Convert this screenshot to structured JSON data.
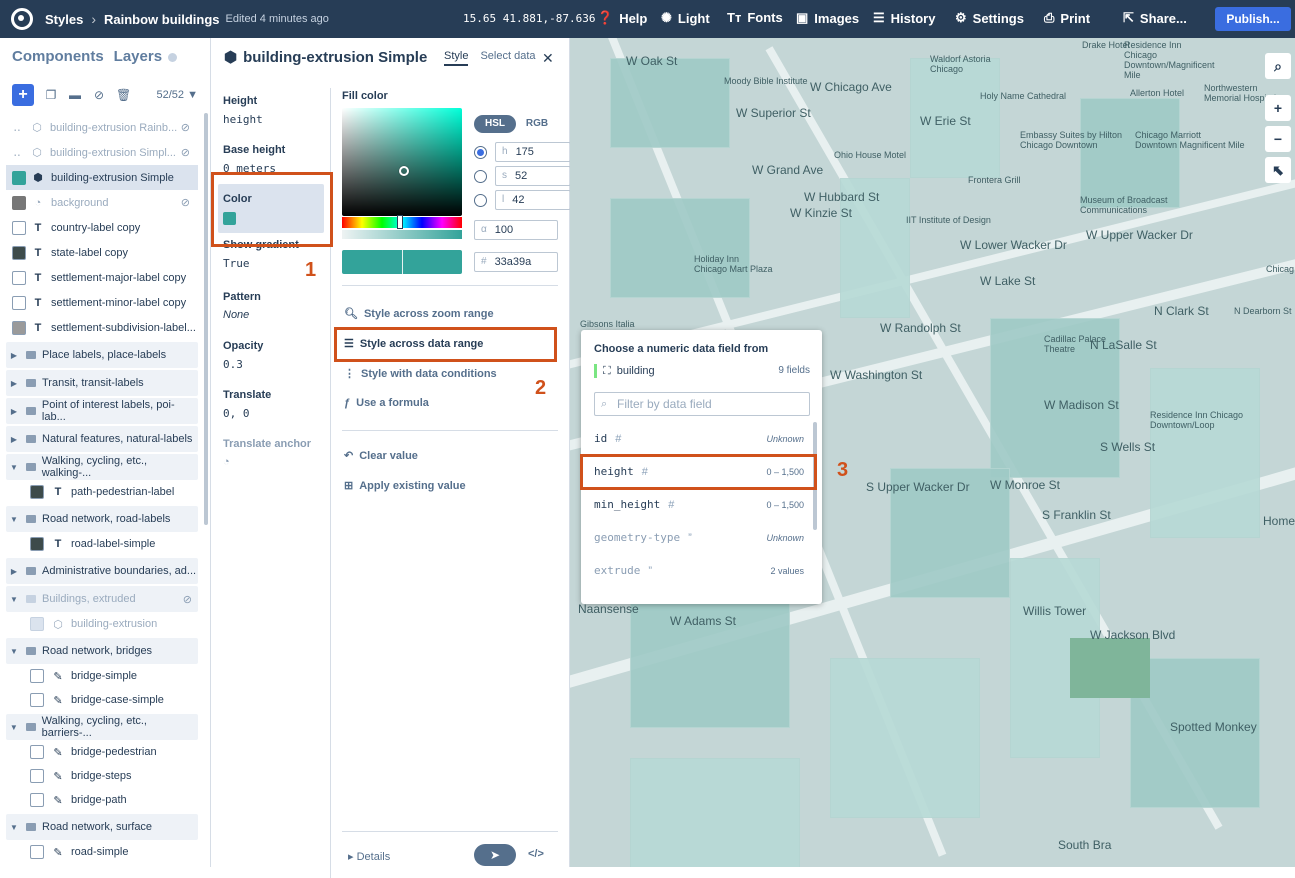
{
  "topbar": {
    "crumb1": "Styles",
    "crumb2": "Rainbow buildings",
    "edited": "Edited 4 minutes ago",
    "coords": "15.65 41.881,-87.636",
    "help": "Help",
    "light": "Light",
    "fonts": "Fonts",
    "images": "Images",
    "history": "History",
    "settings": "Settings",
    "print": "Print",
    "share": "Share...",
    "publish": "Publish..."
  },
  "leftpanel": {
    "tab_components": "Components",
    "tab_layers": "Layers",
    "layer_count": "52/52",
    "layers": [
      {
        "label": "building-extrusion Rainb...",
        "swatch": "",
        "icon": "cube"
      },
      {
        "label": "building-extrusion Simpl...",
        "swatch": "",
        "icon": "cube"
      },
      {
        "label": "building-extrusion Simple",
        "swatch": "#33a39a",
        "icon": "cube"
      },
      {
        "label": "background",
        "swatch": "#777777",
        "icon": "paint"
      },
      {
        "label": "country-label copy",
        "swatch": "",
        "icon": "T"
      },
      {
        "label": "state-label copy",
        "swatch": "#3d4b4b",
        "icon": "T"
      },
      {
        "label": "settlement-major-label copy",
        "swatch": "",
        "icon": "T"
      },
      {
        "label": "settlement-minor-label copy",
        "swatch": "",
        "icon": "T"
      },
      {
        "label": "settlement-subdivision-label...",
        "swatch": "#9a9a9a",
        "icon": "T"
      }
    ],
    "groups": [
      "Place labels, place-labels",
      "Transit, transit-labels",
      "Point of interest labels, poi-lab...",
      "Natural features, natural-labels",
      "Walking, cycling, etc., walking-...",
      "Road network, road-labels",
      "Administrative boundaries, ad...",
      "Buildings, extruded",
      "Road network, bridges",
      "Walking, cycling, etc., barriers-...",
      "Road network, surface"
    ],
    "children": {
      "path_pedestrian": "path-pedestrian-label",
      "road_label_simple": "road-label-simple",
      "building_extrusion": "building-extrusion",
      "bridge_simple": "bridge-simple",
      "bridge_case_simple": "bridge-case-simple",
      "bridge_pedestrian": "bridge-pedestrian",
      "bridge_steps": "bridge-steps",
      "bridge_path": "bridge-path",
      "road_simple": "road-simple"
    }
  },
  "props": {
    "title": "building-extrusion Simple",
    "tab_style": "Style",
    "tab_select": "Select data",
    "items": [
      {
        "k": "Height",
        "v": "height"
      },
      {
        "k": "Base height",
        "v": "0 meters"
      },
      {
        "k": "Color",
        "v": ""
      },
      {
        "k": "Show gradient",
        "v": "True"
      },
      {
        "k": "Pattern",
        "v": "None"
      },
      {
        "k": "Opacity",
        "v": "0.3"
      },
      {
        "k": "Translate",
        "v": "0, 0"
      },
      {
        "k": "Translate anchor",
        "v": ""
      }
    ],
    "fill_color": "Fill color",
    "mode_hsl": "HSL",
    "mode_rgb": "RGB",
    "h": "175",
    "s": "52",
    "l": "42",
    "alpha": "100",
    "hex": "33a39a",
    "opt_zoom": "Style across zoom range",
    "opt_data": "Style across data range",
    "opt_cond": "Style with data conditions",
    "opt_formula": "Use a formula",
    "clear": "Clear value",
    "apply": "Apply existing value",
    "details": "Details"
  },
  "dropdown": {
    "title": "Choose a numeric data field from",
    "source": "building",
    "count": "9 fields",
    "placeholder": "Filter by data field",
    "fields": [
      {
        "name": "id",
        "range": "Unknown"
      },
      {
        "name": "height",
        "range": "0 – 1,500"
      },
      {
        "name": "min_height",
        "range": "0 – 1,500"
      },
      {
        "name": "geometry-type",
        "range": "Unknown"
      },
      {
        "name": "extrude",
        "range": "2 values"
      }
    ]
  },
  "map": {
    "labels": [
      "Drake Hotel",
      "Residence Inn Chicago Downtown/Magnificent Mile",
      "W Oak St",
      "Waldorf Astoria Chicago",
      "Moody Bible Institute",
      "W Chicago Ave",
      "Holy Name Cathedral",
      "Allerton Hotel",
      "Northwestern Memorial Hospital",
      "W Superior St",
      "W Erie St",
      "Embassy Suites by Hilton Chicago Downtown",
      "Chicago Marriott Downtown Magnificent Mile",
      "Ohio House Motel",
      "W Grand Ave",
      "Frontera Grill",
      "W Hubbard St",
      "W Kinzie St",
      "Museum of Broadcast Communications",
      "IIT Institute of Design",
      "W Lower Wacker Dr",
      "W Upper Wacker Dr",
      "Holiday Inn Chicago Mart Plaza",
      "W Lake St",
      "Gibsons Italia",
      "W Randolph St",
      "Cadillac Palace Theatre",
      "N LaSalle St",
      "N Clark St",
      "N Dearborn St",
      "W Washington St",
      "W Madison St",
      "Residence Inn Chicago Downtown/Loop",
      "S Wells St",
      "W Monroe St",
      "S Franklin St",
      "S Upper Wacker Dr",
      "Willis Tower",
      "W Jackson Blvd",
      "W Adams St",
      "Spotted Monkey",
      "Naansense",
      "Home",
      "Chicag",
      "South Bra"
    ]
  },
  "annotations": {
    "n1": "1",
    "n2": "2",
    "n3": "3"
  },
  "colors": {
    "accent": "#d0511b",
    "topbar": "#273d56",
    "publish": "#3a6de0",
    "fill": "#33a39a"
  }
}
